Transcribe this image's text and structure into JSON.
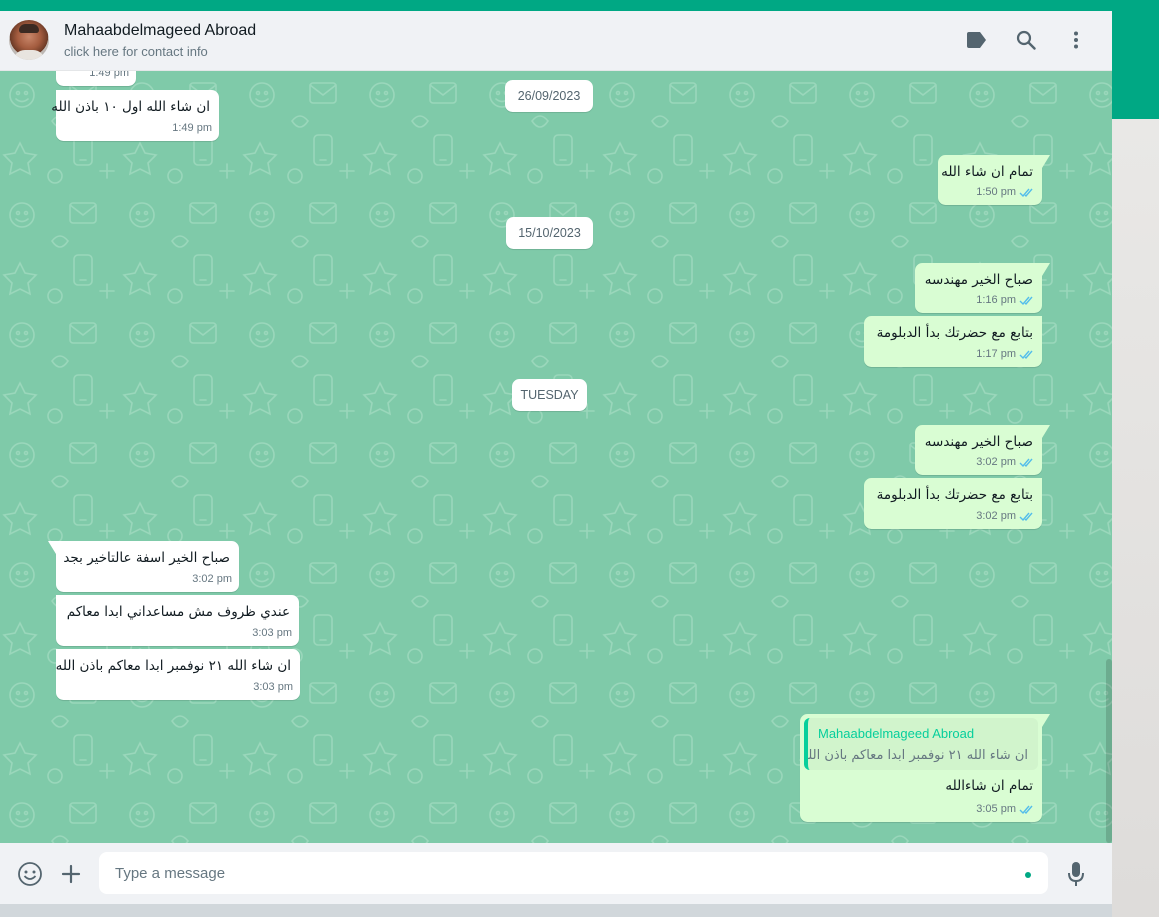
{
  "colors": {
    "accent": "#00a884",
    "chat_background": "#7fcaa9",
    "incoming_bubble": "#ffffff",
    "outgoing_bubble": "#d9fdd3",
    "read_ticks": "#53bdeb",
    "quote_name": "#06cf9c"
  },
  "header": {
    "contact_name": "Mahaabdelmageed Abroad",
    "subtitle": "click here for contact info",
    "icons": [
      "label-icon",
      "search-icon",
      "menu-icon"
    ]
  },
  "chat": {
    "dates": [
      "26/09/2023",
      "15/10/2023",
      "TUESDAY"
    ],
    "messages": [
      {
        "dir": "in",
        "text": "",
        "time": "1:49 pm"
      },
      {
        "dir": "in",
        "text": "ان شاء الله اول ١٠ باذن الله",
        "time": "1:49 pm"
      },
      {
        "dir": "out",
        "text": "تمام ان شاء الله",
        "time": "1:50 pm",
        "read": true
      },
      {
        "dir": "out",
        "text": "صباح الخير مهندسه",
        "time": "1:16 pm",
        "read": true
      },
      {
        "dir": "out",
        "text": "بتابع مع حضرتك بدأ الدبلومة",
        "time": "1:17 pm",
        "read": true
      },
      {
        "dir": "out",
        "text": "صباح الخير مهندسه",
        "time": "3:02 pm",
        "read": true
      },
      {
        "dir": "out",
        "text": "بتابع مع حضرتك بدأ الدبلومة",
        "time": "3:02 pm",
        "read": true
      },
      {
        "dir": "in",
        "text": "صباح الخير اسفة عالتاخير بجد",
        "time": "3:02 pm"
      },
      {
        "dir": "in",
        "text": "عندي ظروف مش مساعداني ابدا معاكم",
        "time": "3:03 pm"
      },
      {
        "dir": "in",
        "text": "ان شاء الله ٢١ نوفمبر ابدا معاكم باذن الله",
        "time": "3:03 pm"
      },
      {
        "dir": "out",
        "text": "تمام ان شاءالله",
        "time": "3:05 pm",
        "read": true,
        "quote": {
          "name": "Mahaabdelmageed Abroad",
          "text": "ان شاء الله ٢١ نوفمبر ابدا معاكم باذن الله"
        }
      }
    ]
  },
  "composer": {
    "placeholder": "Type a message",
    "icons": [
      "emoji-icon",
      "attach-plus-icon",
      "microphone-icon"
    ]
  }
}
